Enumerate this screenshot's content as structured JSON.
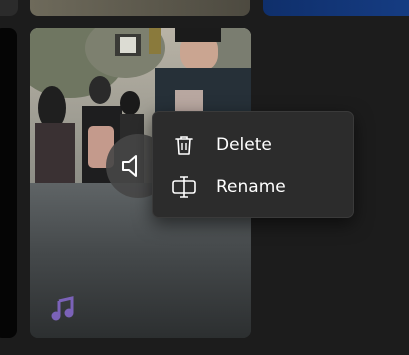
{
  "context_menu": {
    "items": [
      {
        "label": "Delete",
        "icon": "trash-icon"
      },
      {
        "label": "Rename",
        "icon": "rename-icon"
      }
    ]
  },
  "media_card": {
    "type_icon": "music-note-icon",
    "overlay_icon": "speaker-icon"
  },
  "colors": {
    "menu_background": "#2c2c2c",
    "page_background": "#1c1c1c",
    "music_badge": "#7b62b8",
    "menu_text": "#ffffff"
  }
}
